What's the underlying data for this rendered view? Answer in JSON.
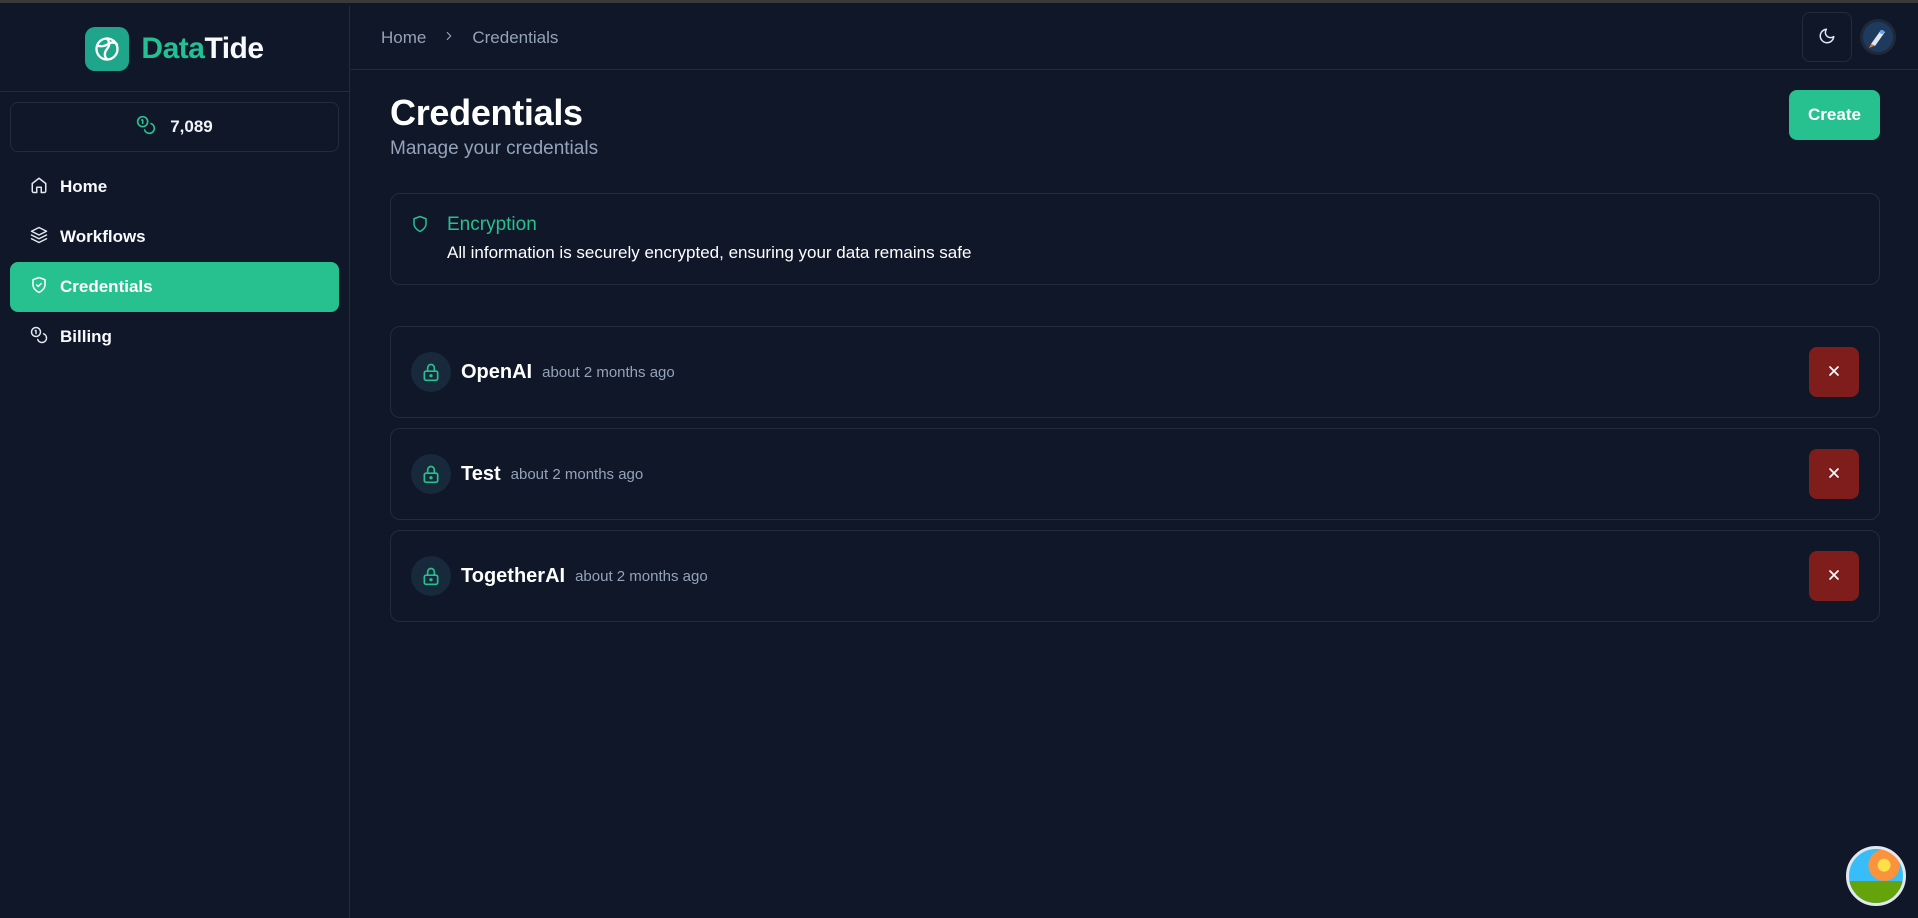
{
  "brand": {
    "part1": "Data",
    "part2": "Tide"
  },
  "credits": {
    "value": "7,089"
  },
  "sidebar": {
    "items": [
      {
        "label": "Home",
        "icon": "home-icon",
        "active": false
      },
      {
        "label": "Workflows",
        "icon": "layers-icon",
        "active": false
      },
      {
        "label": "Credentials",
        "icon": "shield-check-icon",
        "active": true
      },
      {
        "label": "Billing",
        "icon": "coins-icon",
        "active": false
      }
    ]
  },
  "breadcrumb": {
    "home": "Home",
    "separator": ">",
    "current": "Credentials"
  },
  "page": {
    "title": "Credentials",
    "subtitle": "Manage your credentials",
    "create_label": "Create"
  },
  "alert": {
    "title": "Encryption",
    "description": "All information is securely encrypted, ensuring your data remains safe"
  },
  "credentials": [
    {
      "name": "OpenAI",
      "time": "about 2 months ago"
    },
    {
      "name": "Test",
      "time": "about 2 months ago"
    },
    {
      "name": "TogetherAI",
      "time": "about 2 months ago"
    }
  ],
  "colors": {
    "background": "#0f1729",
    "accent": "#27c08f",
    "danger": "#7f1d1d",
    "muted": "#94a3b8",
    "border": "#232c3d"
  }
}
